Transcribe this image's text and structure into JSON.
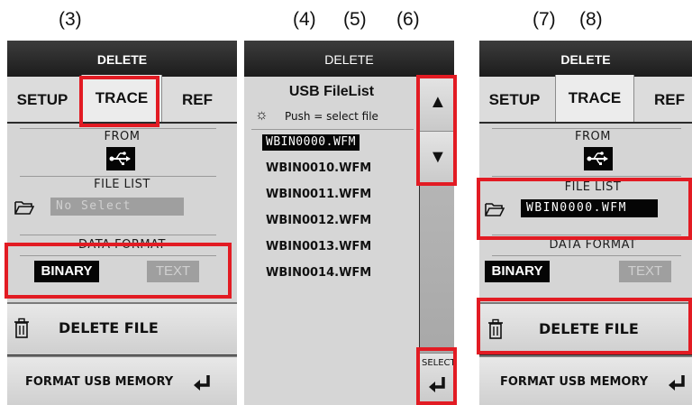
{
  "figure_numbers": [
    "(3)",
    "(4)",
    "(5)",
    "(6)",
    "(7)",
    "(8)"
  ],
  "panel_left": {
    "title": "DELETE",
    "tabs": [
      "SETUP",
      "TRACE",
      "REF"
    ],
    "active_tab": "TRACE",
    "from_label": "FROM",
    "file_list_label": "FILE LIST",
    "file_value": "No Select",
    "data_format_label": "DATA FORMAT",
    "format_binary": "BINARY",
    "format_text": "TEXT",
    "delete_file": "DELETE FILE",
    "format_usb": "FORMAT USB MEMORY"
  },
  "panel_middle": {
    "title": "DELETE",
    "list_title": "USB FileList",
    "hint": "Push = select file",
    "files": [
      "WBIN0000.WFM",
      "WBIN0010.WFM",
      "WBIN0011.WFM",
      "WBIN0012.WFM",
      "WBIN0013.WFM",
      "WBIN0014.WFM"
    ],
    "selected_index": 0,
    "up_arrow": "▲",
    "down_arrow": "▼",
    "select_label": "SELECT"
  },
  "panel_right": {
    "title": "DELETE",
    "tabs": [
      "SETUP",
      "TRACE",
      "REF"
    ],
    "active_tab": "TRACE",
    "from_label": "FROM",
    "file_list_label": "FILE LIST",
    "file_value": "WBIN0000.WFM",
    "data_format_label": "DATA FORMAT",
    "format_binary": "BINARY",
    "format_text": "TEXT",
    "delete_file": "DELETE FILE",
    "format_usb": "FORMAT USB MEMORY"
  },
  "colors": {
    "highlight_border": "#e21b23",
    "title_bar": "#1c1c1c",
    "content_bg": "#d5d5d5"
  },
  "icons": [
    "usb-icon",
    "folder-icon",
    "trash-icon",
    "enter-icon",
    "sun-icon",
    "up-arrow-icon",
    "down-arrow-icon"
  ]
}
